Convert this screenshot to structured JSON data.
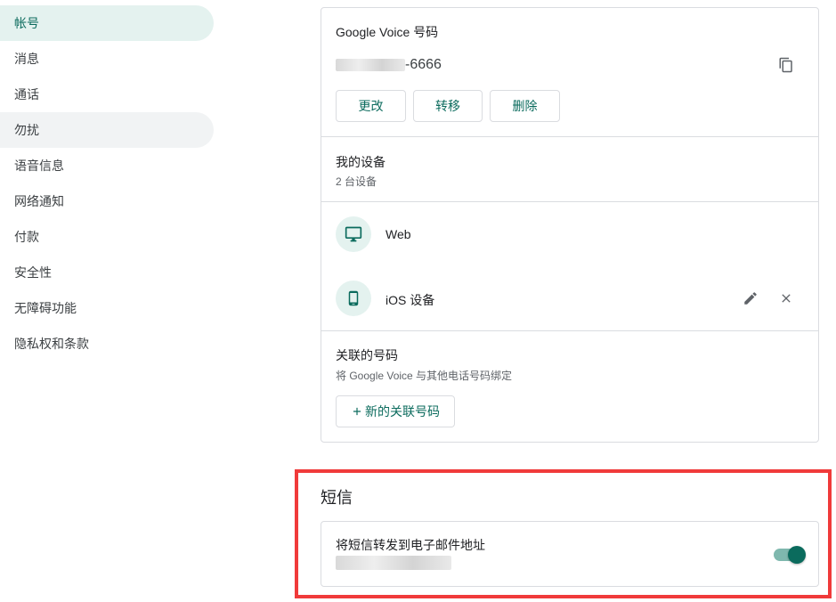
{
  "sidebar": {
    "items": [
      {
        "label": "帐号"
      },
      {
        "label": "消息"
      },
      {
        "label": "通话"
      },
      {
        "label": "勿扰"
      },
      {
        "label": "语音信息"
      },
      {
        "label": "网络通知"
      },
      {
        "label": "付款"
      },
      {
        "label": "安全性"
      },
      {
        "label": "无障碍功能"
      },
      {
        "label": "隐私权和条款"
      }
    ]
  },
  "gv_number": {
    "title": "Google Voice 号码",
    "number_suffix": "-6666",
    "buttons": {
      "change": "更改",
      "transfer": "转移",
      "delete": "删除"
    }
  },
  "devices": {
    "title": "我的设备",
    "count": "2 台设备",
    "items": [
      {
        "label": "Web",
        "icon": "monitor-icon"
      },
      {
        "label": "iOS 设备",
        "icon": "phone-icon"
      }
    ]
  },
  "linked": {
    "title": "关联的号码",
    "subtitle": "将 Google Voice 与其他电话号码绑定",
    "new_button": "新的关联号码"
  },
  "sms": {
    "title": "短信",
    "forward_label": "将短信转发到电子邮件地址",
    "forward_enabled": true
  },
  "colors": {
    "accent": "#0b6b5d",
    "accent_light": "#e4f2ef",
    "highlight_border": "#f03a3a"
  }
}
